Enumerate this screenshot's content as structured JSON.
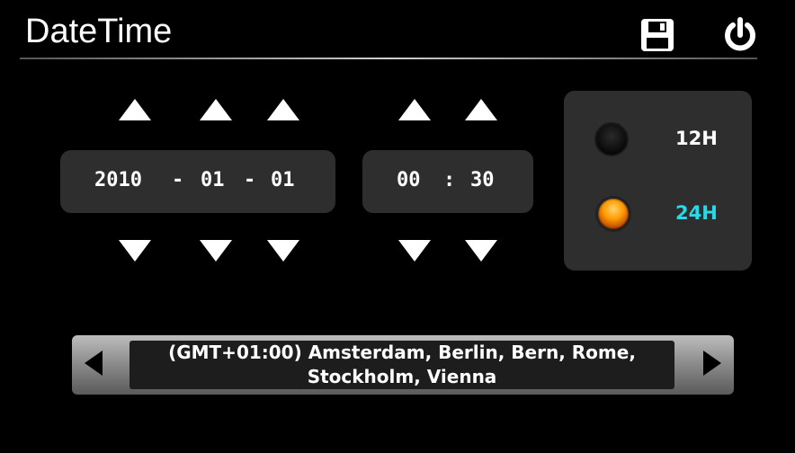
{
  "header": {
    "title": "DateTime",
    "save_icon": "floppy-disk-icon",
    "power_icon": "power-icon"
  },
  "date": {
    "year": "2010",
    "month": "01",
    "day": "01",
    "separator": "-"
  },
  "time": {
    "hour": "00",
    "minute": "30",
    "separator": ":"
  },
  "clock_mode": {
    "options": [
      {
        "label": "12H",
        "selected": false
      },
      {
        "label": "24H",
        "selected": true
      }
    ]
  },
  "timezone": {
    "value": "(GMT+01:00) Amsterdam, Berlin, Bern, Rome, Stockholm, Vienna"
  },
  "colors": {
    "background": "#000000",
    "panel": "#2e2e2e",
    "text": "#ffffff",
    "accent": "#29d9e8",
    "radio_on": "#ff9a00"
  }
}
